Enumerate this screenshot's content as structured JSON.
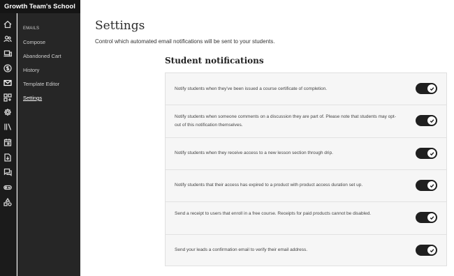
{
  "app": {
    "school_name": "Growth Team's School"
  },
  "rail": {
    "icons": [
      "home-icon",
      "users-icon",
      "devices-icon",
      "dollar-icon",
      "mail-icon",
      "apps-icon",
      "gear-icon",
      "library-icon",
      "calendar-icon",
      "download-icon",
      "chat-icon",
      "key-icon",
      "shapes-icon"
    ]
  },
  "subnav": {
    "heading": "EMAILS",
    "items": [
      {
        "label": "Compose"
      },
      {
        "label": "Abandoned Cart"
      },
      {
        "label": "History"
      },
      {
        "label": "Template Editor"
      },
      {
        "label": "Settings",
        "active": true
      }
    ]
  },
  "main": {
    "title": "Settings",
    "description": "Control which automated email notifications will be sent to your students.",
    "section_title": "Student notifications",
    "notifications": [
      {
        "text": "Notify students when they've been issued a course certificate of completion.",
        "enabled": true
      },
      {
        "text": "Notify students when someone comments on a discussion they are part of. Please note that students may opt-out of this notification themselves.",
        "enabled": true
      },
      {
        "text": "Notify students when they receive access to a new lesson section through drip.",
        "enabled": true
      },
      {
        "text": "Notify students that their access has expired to a product with product access duration set up.",
        "enabled": true
      },
      {
        "text": "Send a receipt to users that enroll in a free course. Receipts for paid products cannot be disabled.",
        "enabled": true
      },
      {
        "text": "Send your leads a confirmation email to verify their email address.",
        "enabled": true
      }
    ]
  },
  "colors": {
    "sidebar": "#1b1b1b",
    "subnav": "#262626",
    "toggle_on": "#1f1f1f",
    "panel": "#f6f6f6"
  }
}
